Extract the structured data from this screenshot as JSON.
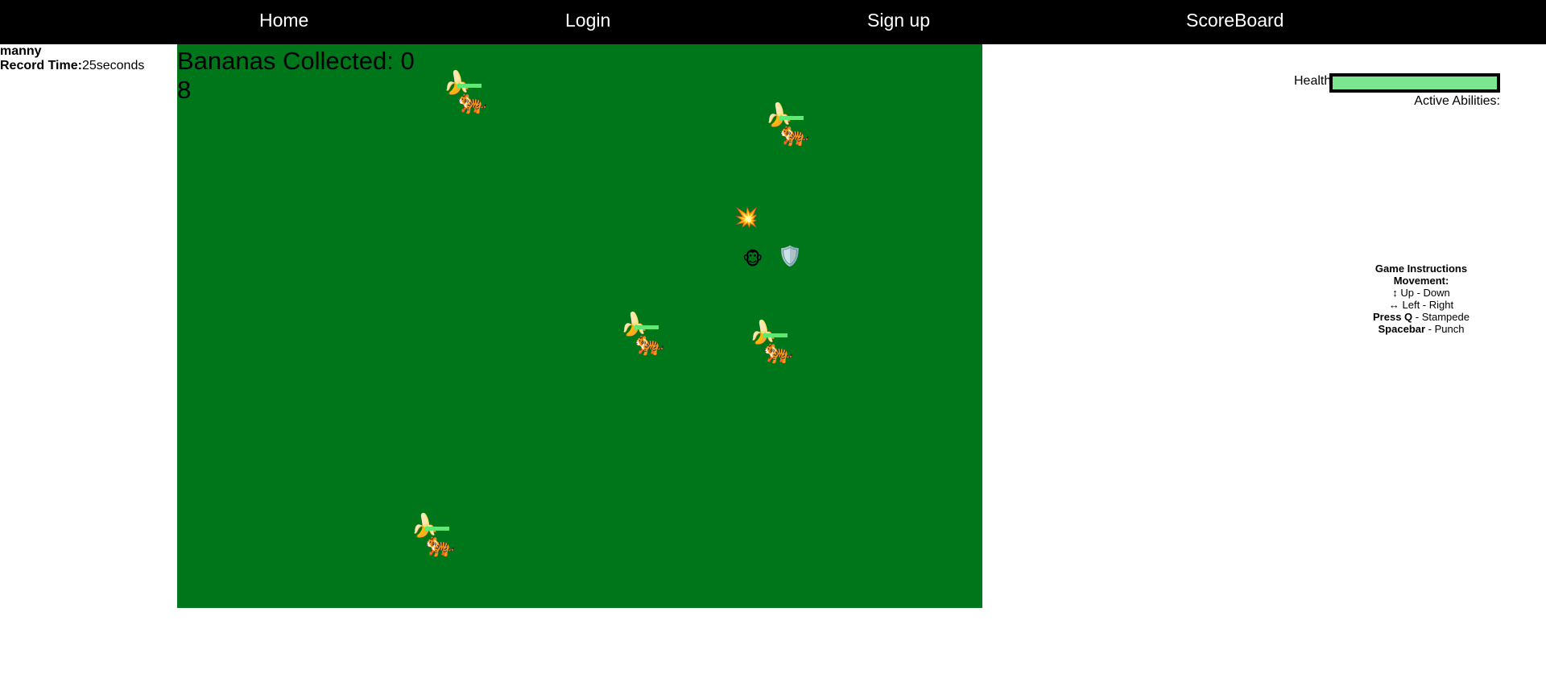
{
  "nav": {
    "items": [
      {
        "label": "Home"
      },
      {
        "label": "Login"
      },
      {
        "label": "Sign up"
      },
      {
        "label": "ScoreBoard"
      }
    ]
  },
  "user": {
    "name": "manny",
    "record_label": "Record Time:",
    "record_value": "25seconds"
  },
  "game": {
    "bananas_text": "Bananas Collected: 0",
    "timer_value": "8",
    "background_color": "#00761b",
    "enemies": [
      {
        "type": "tiger",
        "carrying": "banana",
        "health_bar_color": "#5fe873"
      },
      {
        "type": "tiger",
        "carrying": "banana",
        "health_bar_color": "#5fe873"
      },
      {
        "type": "tiger",
        "carrying": "banana",
        "health_bar_color": "#5fe873"
      },
      {
        "type": "tiger",
        "carrying": "banana",
        "health_bar_color": "#5fe873"
      },
      {
        "type": "tiger",
        "carrying": "banana",
        "health_bar_color": "#5fe873"
      }
    ],
    "player": {
      "icon": "monkey-icon"
    },
    "shield": {
      "icon": "shield-icon"
    },
    "punch_effect": {
      "icon": "explosion-icon"
    }
  },
  "status": {
    "health_label": "Health",
    "health_fraction": 1.0,
    "health_color": "#7ce58f",
    "abilities_label": "Active Abilities:"
  },
  "instructions": {
    "title": "Game Instructions",
    "movement_title": "Movement:",
    "up_down": "↕ Up - Down",
    "left_right": "↔ Left - Right",
    "stampede_key": "Press Q",
    "stampede_action": " - Stampede",
    "punch_key": "Spacebar",
    "punch_action": " - Punch"
  }
}
